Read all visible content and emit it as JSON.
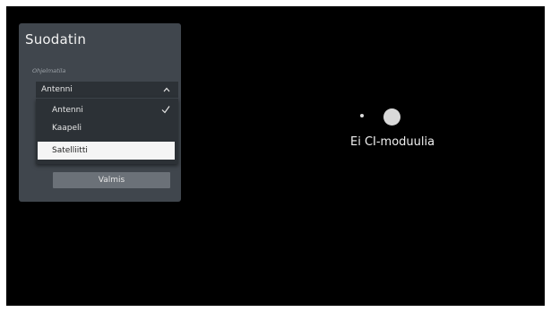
{
  "filter_panel": {
    "title": "Suodatin",
    "field_label": "Ohjelmatila",
    "selected_value": "Antenni",
    "options": [
      {
        "label": "Antenni",
        "checked": true,
        "focused": false
      },
      {
        "label": "Kaapeli",
        "checked": false,
        "focused": false
      },
      {
        "label": "Satelliitti",
        "checked": false,
        "focused": true
      }
    ],
    "done_label": "Valmis"
  },
  "status": {
    "message": "Ei CI-moduulia"
  },
  "colors": {
    "background": "#000000",
    "panel": "#40464d",
    "focused_option": "#f5f5f5",
    "button": "#6b7178"
  },
  "icons": {
    "select_arrow": "chevron-up-icon",
    "option_check": "checkmark-icon",
    "loading": "loading-dots-icon"
  }
}
